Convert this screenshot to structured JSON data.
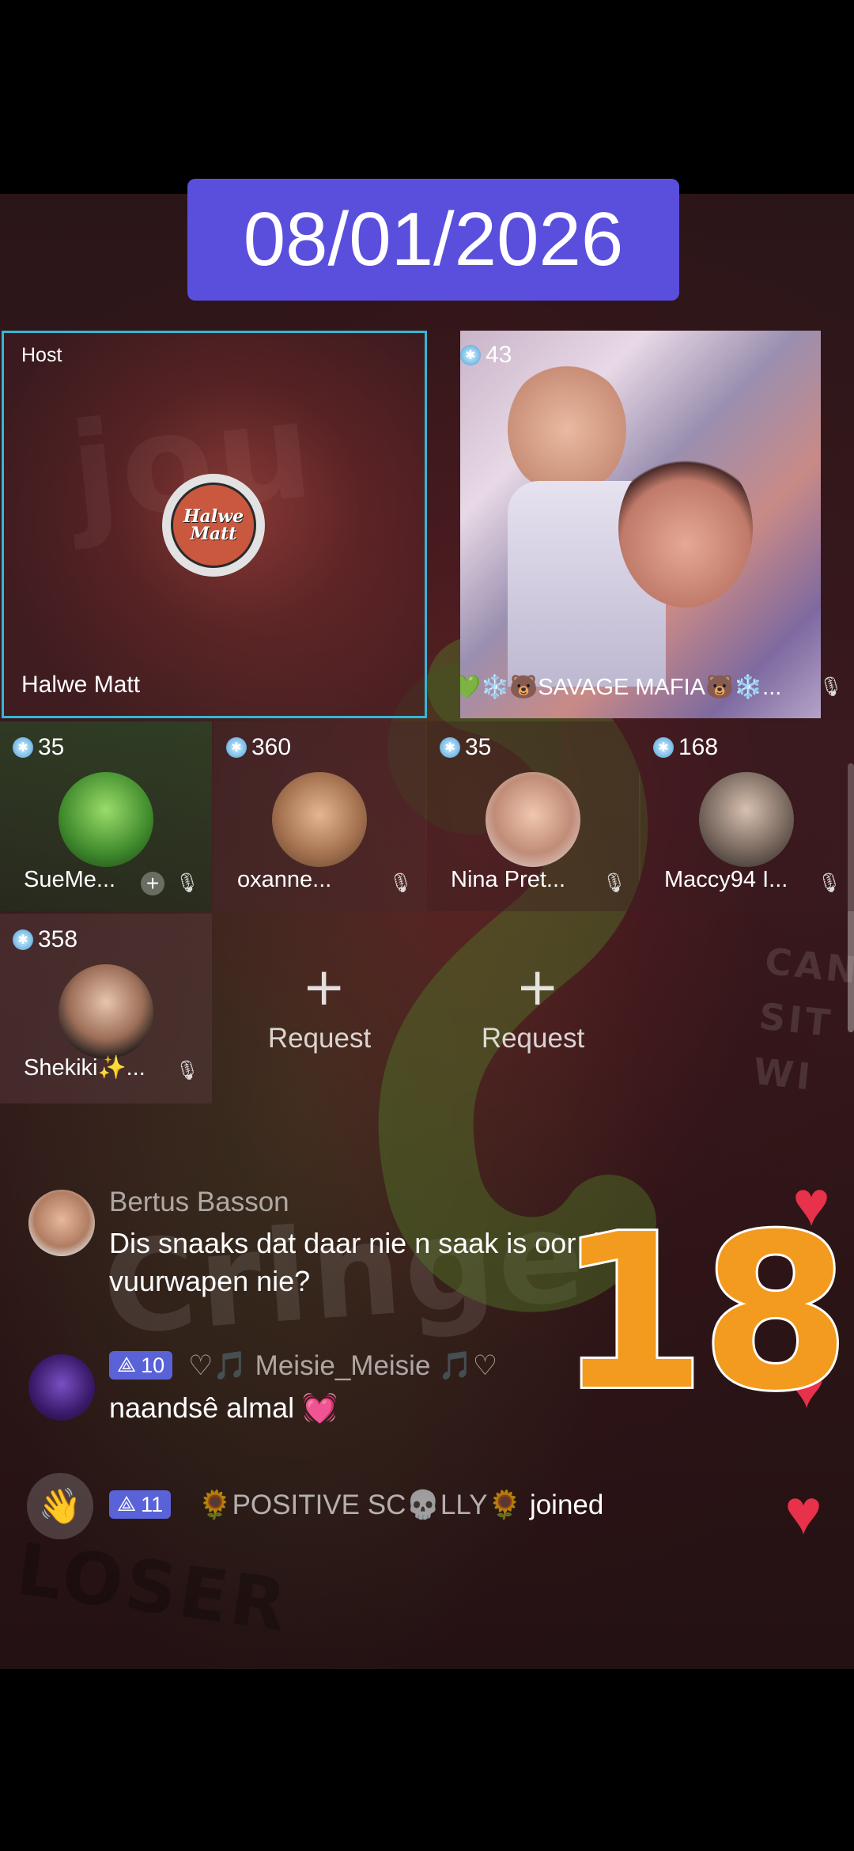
{
  "date_badge": "08/01/2026",
  "overlay_number": "18",
  "background_words": [
    "jou",
    "Cringe",
    "LOSER",
    "CAN'T SIT WI"
  ],
  "host": {
    "label": "Host",
    "name": "Halwe Matt",
    "logo_line1": "Halwe",
    "logo_line2": "Matt"
  },
  "guest_main": {
    "count": "43",
    "name": "💚❄️🐻SAVAGE MAFIA🐻❄️..."
  },
  "guests": [
    {
      "count": "35",
      "name": "SueMe...",
      "mic": "muted",
      "has_add": true
    },
    {
      "count": "360",
      "name": "oxanne...",
      "mic": "muted",
      "has_add": false
    },
    {
      "count": "35",
      "name": "Nina Pret...",
      "mic": "muted",
      "has_add": false
    },
    {
      "count": "168",
      "name": "Maccy94 I...",
      "mic": "muted",
      "has_add": false
    },
    {
      "count": "358",
      "name": "Shekiki✨...",
      "mic": "muted",
      "has_add": false
    }
  ],
  "request_label": "Request",
  "chat": [
    {
      "user": "Bertus Basson",
      "message_line1": "Dis snaaks dat daar nie n saak is oor die",
      "message_line2": "vuurwapen nie?"
    },
    {
      "level": "10",
      "user": "♡🎵 Meisie_Meisie 🎵♡",
      "message": "naandsê almal 💓"
    }
  ],
  "join_event": {
    "level": "11",
    "user": "🌻POSITIVE SC💀LLY🌻",
    "action": "joined"
  },
  "colors": {
    "date_badge_bg": "#5a4fdd",
    "host_border": "#35b6d6",
    "level_badge": "#5a62d8",
    "heart": "#e8314a",
    "overlay_number": "#f39b1f"
  }
}
